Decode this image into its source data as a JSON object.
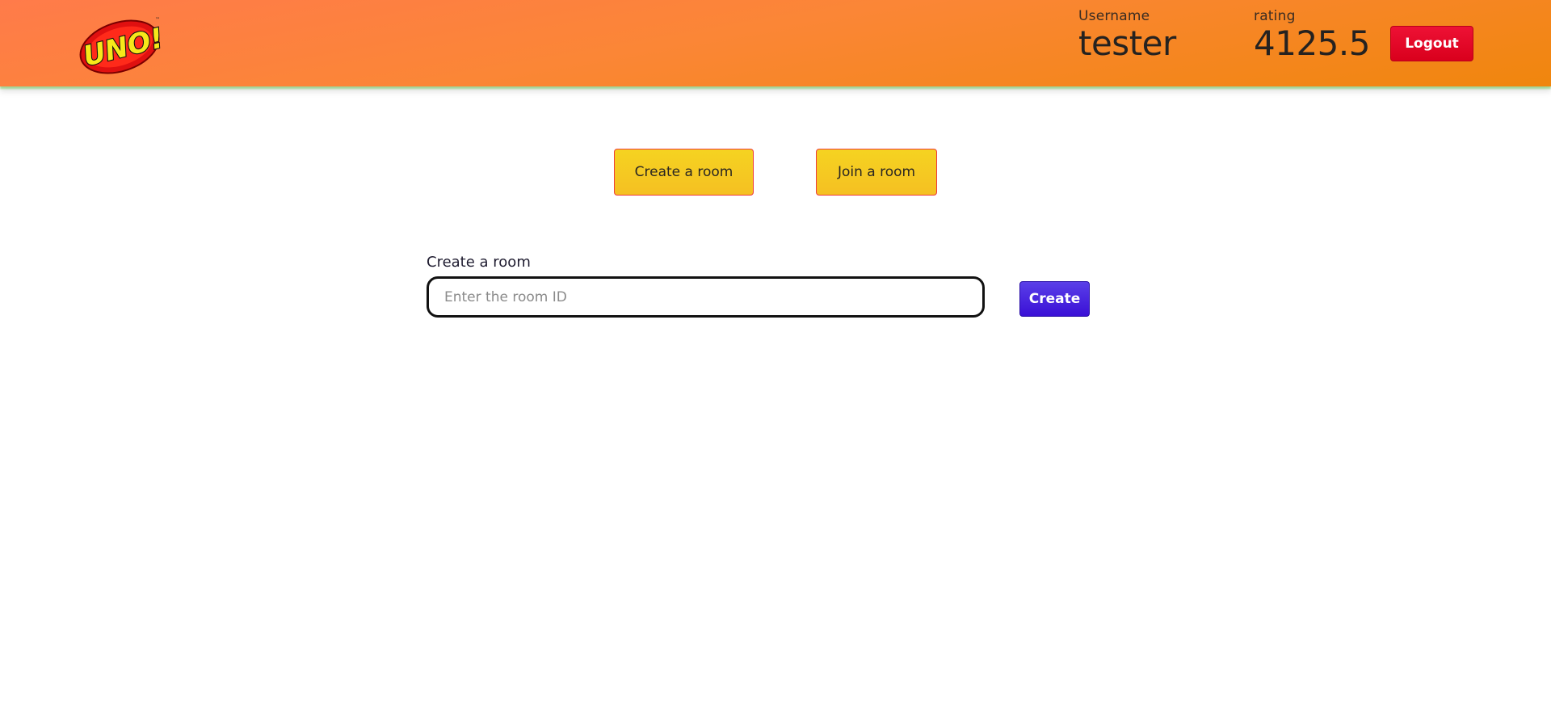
{
  "header": {
    "logo": {
      "icon": "uno-logo-icon",
      "text": "UNO!"
    },
    "username": {
      "label": "Username",
      "value": "tester"
    },
    "rating": {
      "label": "rating",
      "value": "4125.5"
    },
    "logout_label": "Logout"
  },
  "modes": {
    "create_label": "Create a room",
    "join_label": "Join a room"
  },
  "form": {
    "label": "Create a room",
    "input_value": "",
    "input_placeholder": "Enter the room ID",
    "submit_label": "Create"
  },
  "colors": {
    "header_start": "#ff7b4a",
    "header_end": "#f0860d",
    "logout": "#e0001f",
    "mode_button": "#f5c822",
    "create_button": "#4a2ae0"
  }
}
